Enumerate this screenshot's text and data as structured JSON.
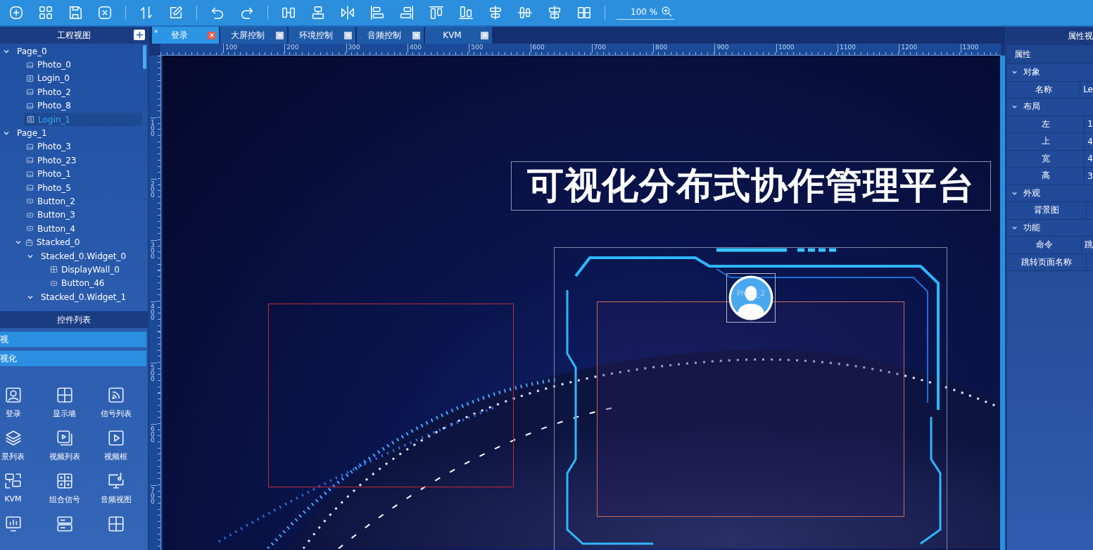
{
  "toolbar": {
    "zoom": "100 %"
  },
  "project_panel": {
    "title": "工程视图",
    "tree": [
      {
        "label": "Page_0",
        "kind": "page",
        "expanded": true,
        "selected": false,
        "children": [
          {
            "label": "Photo_0",
            "kind": "photo",
            "selected": false
          },
          {
            "label": "Login_0",
            "kind": "login",
            "selected": false
          },
          {
            "label": "Photo_2",
            "kind": "photo",
            "selected": false
          },
          {
            "label": "Photo_8",
            "kind": "photo",
            "selected": false
          },
          {
            "label": "Login_1",
            "kind": "login",
            "selected": true
          }
        ]
      },
      {
        "label": "Page_1",
        "kind": "page",
        "expanded": true,
        "selected": false,
        "children": [
          {
            "label": "Photo_3",
            "kind": "photo",
            "selected": false
          },
          {
            "label": "Photo_23",
            "kind": "photo",
            "selected": false
          },
          {
            "label": "Photo_1",
            "kind": "photo",
            "selected": false
          },
          {
            "label": "Photo_5",
            "kind": "photo",
            "selected": false
          },
          {
            "label": "Button_2",
            "kind": "button",
            "selected": false
          },
          {
            "label": "Button_3",
            "kind": "button",
            "selected": false
          },
          {
            "label": "Button_4",
            "kind": "button",
            "selected": false
          },
          {
            "label": "Stacked_0",
            "kind": "stacked",
            "expanded": true,
            "selected": false,
            "children": [
              {
                "label": "Stacked_0.Widget_0",
                "kind": "widget",
                "expanded": true,
                "selected": false,
                "children": [
                  {
                    "label": "DisplayWall_0",
                    "kind": "displaywall",
                    "selected": false
                  },
                  {
                    "label": "Button_46",
                    "kind": "button",
                    "selected": false
                  }
                ]
              },
              {
                "label": "Stacked_0.Widget_1",
                "kind": "widget",
                "expanded": true,
                "selected": false
              }
            ]
          }
        ]
      }
    ]
  },
  "widget_panel": {
    "title": "控件列表",
    "categories": [
      "视",
      "视化"
    ],
    "widgets": [
      {
        "label": "登录"
      },
      {
        "label": "显示墙"
      },
      {
        "label": "信号列表"
      },
      {
        "label": "景列表"
      },
      {
        "label": "视频列表"
      },
      {
        "label": "视频框"
      },
      {
        "label": "KVM"
      },
      {
        "label": "组合信号"
      },
      {
        "label": "音频视图"
      }
    ]
  },
  "tabs": [
    {
      "label": "登录",
      "mark": "*",
      "selected": true
    },
    {
      "label": "大屏控制",
      "selected": false
    },
    {
      "label": "环境控制",
      "selected": false
    },
    {
      "label": "音频控制",
      "selected": false
    },
    {
      "label": "KVM",
      "selected": false
    }
  ],
  "rulers": {
    "horizontal": [
      "100",
      "200",
      "300",
      "400",
      "500",
      "600",
      "700",
      "800",
      "900",
      "1000",
      "1100",
      "1200",
      "1300"
    ],
    "vertical": [
      "100",
      "200",
      "300",
      "400",
      "500",
      "600",
      "700"
    ]
  },
  "canvas": {
    "title": "可视化分布式协作管理平台",
    "avatar_label": "Photo_2"
  },
  "properties_panel": {
    "title": "属性视",
    "header": "属性",
    "groups": [
      {
        "title": "对象",
        "expanded": true,
        "rows": [
          {
            "name": "名称",
            "value": "Le"
          }
        ]
      },
      {
        "title": "布局",
        "expanded": true,
        "rows": [
          {
            "name": "左",
            "value": "1"
          },
          {
            "name": "上",
            "value": "4"
          },
          {
            "name": "宽",
            "value": "4"
          },
          {
            "name": "高",
            "value": "3"
          }
        ]
      },
      {
        "title": "外观",
        "expanded": true,
        "rows": [
          {
            "name": "背景图"
          }
        ]
      },
      {
        "title": "功能",
        "expanded": true,
        "rows": [
          {
            "name": "命令",
            "value": "跳"
          },
          {
            "name": "跳转页面名称"
          }
        ]
      }
    ]
  }
}
